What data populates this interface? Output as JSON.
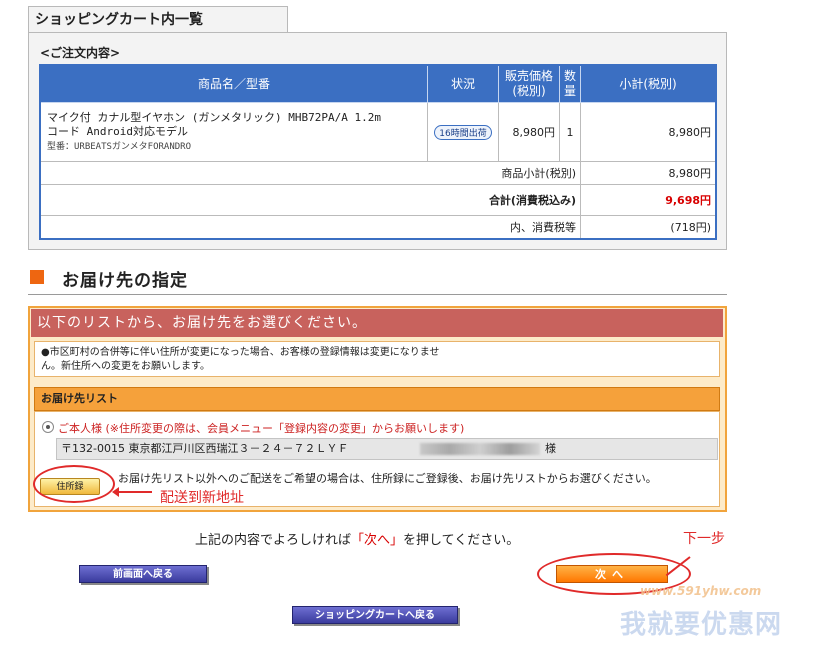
{
  "cart": {
    "tab_title": "ショッピングカート内一覧",
    "order_label": "<ご注文内容>",
    "headers": {
      "product": "商品名／型番",
      "status": "状況",
      "price_line1": "販売価格",
      "price_line2": "(税別)",
      "qty_line1": "数",
      "qty_line2": "量",
      "subtotal": "小計(税別)"
    },
    "item": {
      "name_line1": "マイク付 カナル型イヤホン (ガンメタリック) MHB72PA/A 1.2m",
      "name_line2": "コード Android対応モデル",
      "model": "型番：URBEATSガンメタFORANDRO",
      "status": "16時間出荷",
      "price": "8,980円",
      "qty": "1",
      "subtotal": "8,980円"
    },
    "summary": {
      "subtotal_label": "商品小計(税別)",
      "subtotal_value": "8,980円",
      "total_label": "合計(消費税込み)",
      "total_value": "9,698円",
      "tax_label": "内、消費税等",
      "tax_value": "(718円)"
    }
  },
  "delivery": {
    "heading": "お届け先の指定",
    "box_title": "以下のリストから、お届け先をお選びください。",
    "notice_line1": "●市区町村の合併等に伴い住所が変更になった場合、お客様の登録情報は変更になりませ",
    "notice_line2": "ん。新住所への変更をお願いします。",
    "list_title": "お届け先リスト",
    "self_label": "ご本人様 (※住所変更の際は、会員メニュー「登録内容の変更」からお願いします)",
    "address": "〒132-0015 東京都江戸川区西瑞江３－２４－７２ＬＹＦ",
    "address_suffix": "様",
    "address_button": "住所録",
    "other_note": "お届け先リスト以外へのご配送をご希望の場合は、住所録にご登録後、お届け先リストからお選びください。"
  },
  "footer": {
    "confirm_prefix": "上記の内容でよろしければ",
    "confirm_highlight": "「次へ」",
    "confirm_suffix": "を押してください。",
    "prev_button": "前画面へ戻る",
    "next_button": "次へ",
    "cart_button": "ショッピングカートへ戻る"
  },
  "annotations": {
    "new_address": "配送到新地址",
    "next_step": "下一步"
  },
  "watermark": {
    "url": "www.591yhw.com",
    "text": "我就要优惠网"
  },
  "colors": {
    "table_header": "#3b6fc2",
    "total_price": "#d80000",
    "box_title_bg": "#c8625d",
    "list_head_bg": "#f5a13b",
    "annotation_red": "#e02a2a"
  }
}
